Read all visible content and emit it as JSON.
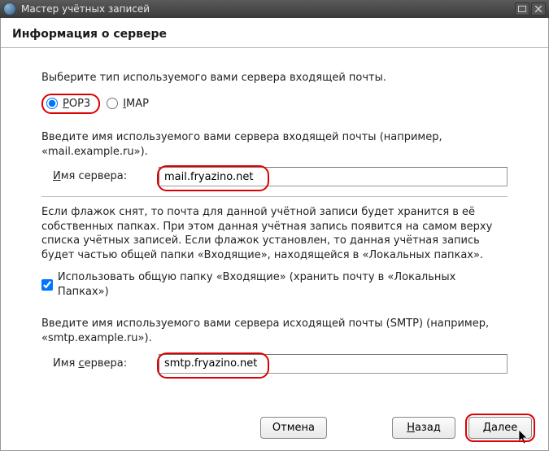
{
  "titlebar": {
    "title": "Мастер учётных записей"
  },
  "heading": "Информация о сервере",
  "instructions": {
    "select_type": "Выберите тип используемого вами сервера входящей почты.",
    "enter_incoming": "Введите имя используемого вами сервера входящей почты (например, «mail.example.ru»).",
    "global_inbox_info": "Если флажок снят, то почта для данной учётной записи будет хранится в её собственных папках. При этом данная учётная запись появится на самом верху списка учётных записей. Если флажок установлен, то данная учётная запись будет частью общей папки «Входящие», находящейся в «Локальных папках».",
    "enter_outgoing": "Введите имя используемого вами сервера исходящей почты (SMTP) (например, «smtp.example.ru»)."
  },
  "radios": {
    "pop3": "POP3",
    "imap": "IMAP",
    "selected": "pop3"
  },
  "fields": {
    "incoming_label_pre": "И",
    "incoming_label_rest": "мя сервера:",
    "incoming_value": "mail.fryazino.net",
    "outgoing_label_pre": "Имя ",
    "outgoing_label_underline": "с",
    "outgoing_label_rest": "ервера:",
    "outgoing_value": "smtp.fryazino.net"
  },
  "checkbox": {
    "label": "Использовать общую папку «Входящие» (хранить почту в «Локальных Папках»)",
    "checked": true
  },
  "buttons": {
    "cancel": "Отмена",
    "back_pre": "Н",
    "back_rest": "азад",
    "next_pre": "Д",
    "next_rest": "алее"
  }
}
